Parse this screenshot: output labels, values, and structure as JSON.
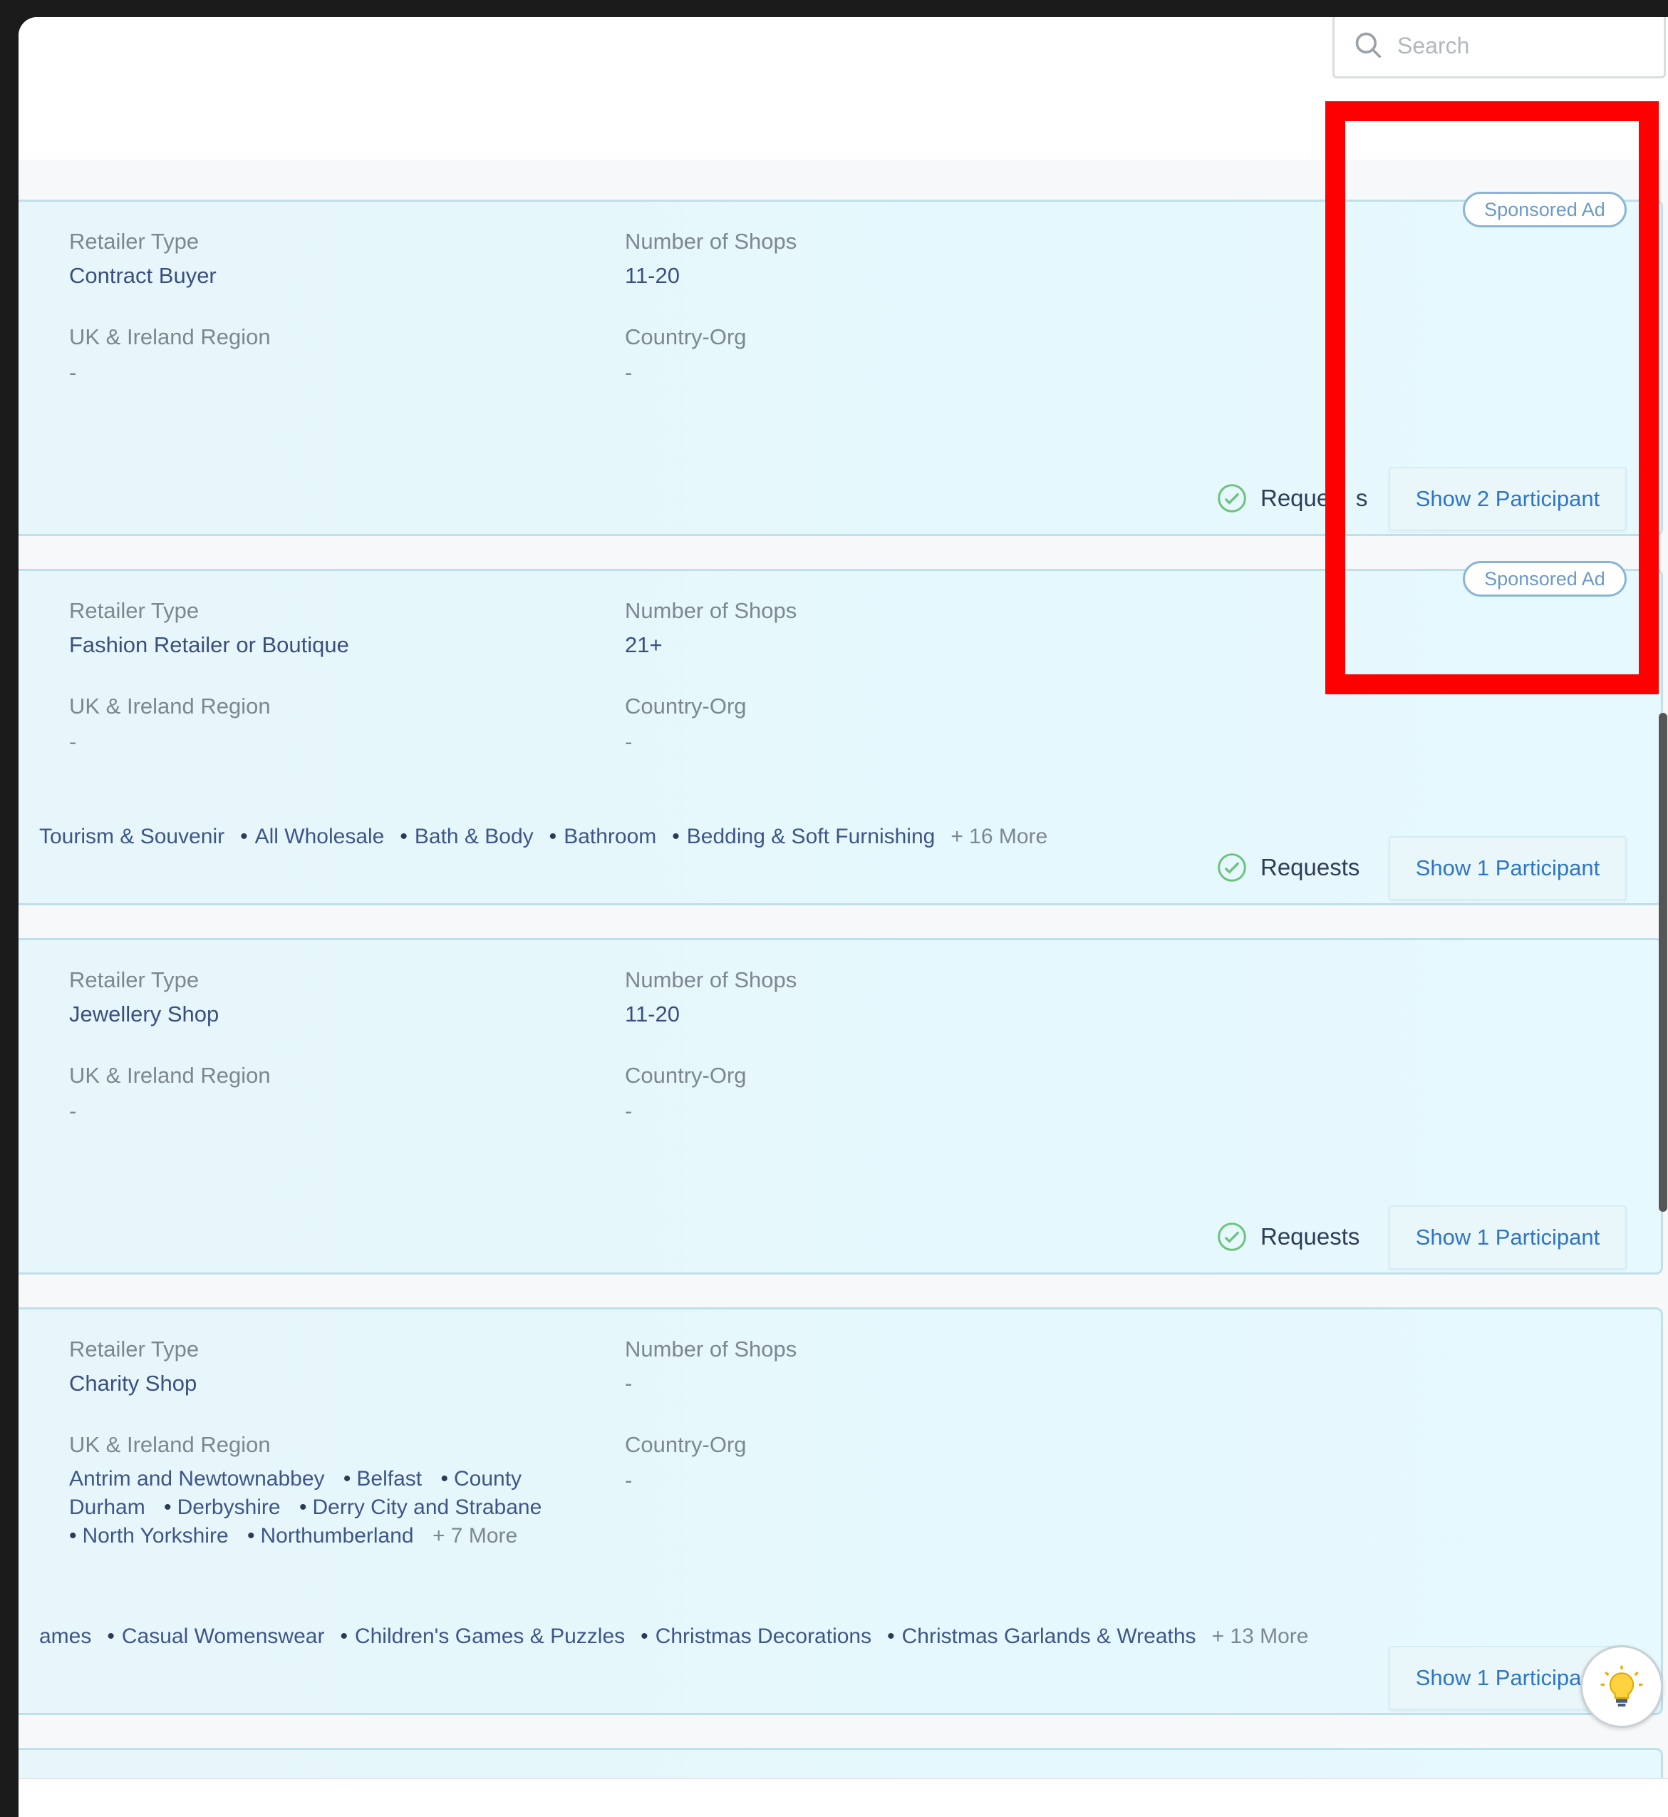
{
  "search": {
    "placeholder": "Search"
  },
  "labels": {
    "retailer_type": "Retailer Type",
    "number_of_shops": "Number of Shops",
    "region": "UK & Ireland Region",
    "country_org": "Country-Org",
    "requests": "Requests",
    "sponsored": "Sponsored Ad"
  },
  "cards": [
    {
      "retailer_type": "Contract Buyer",
      "shops": "11-20",
      "region": "-",
      "country_org": "-",
      "requests_label": "Reque    s",
      "show_button": "Show 2 Participant",
      "sponsored": "Sponsored Ad"
    },
    {
      "retailer_type": "Fashion Retailer or Boutique",
      "shops": "21+",
      "region": "-",
      "country_org": "-",
      "categories": [
        "Tourism & Souvenir",
        "All Wholesale",
        "Bath & Body",
        "Bathroom",
        "Bedding & Soft Furnishing"
      ],
      "categories_more": "+ 16 More",
      "requests_label": "Requests",
      "show_button": "Show 1 Participant",
      "sponsored": "Sponsored Ad"
    },
    {
      "retailer_type": "Jewellery Shop",
      "shops": "11-20",
      "region": "-",
      "country_org": "-",
      "requests_label": "Requests",
      "show_button": "Show 1 Participant"
    },
    {
      "retailer_type": "Charity Shop",
      "shops": "-",
      "regions": [
        "Antrim and Newtownabbey",
        "Belfast",
        "County Durham",
        "Derbyshire",
        "Derry City and Strabane",
        "North Yorkshire",
        "Northumberland"
      ],
      "regions_more": "+ 7 More",
      "country_org": "-",
      "categories": [
        "ames",
        "Casual Womenswear",
        "Children's Games & Puzzles",
        "Christmas Decorations",
        "Christmas Garlands & Wreaths"
      ],
      "categories_more": "+ 13 More",
      "show_button": "Show 1 Participant"
    }
  ],
  "colors": {
    "accent": "#2f75c5",
    "card_bg": "#e6f7fc",
    "annotation": "#ff0000"
  },
  "icons": {
    "search": "search-icon",
    "requests": "check-circle-icon",
    "help": "lightbulb-icon"
  }
}
